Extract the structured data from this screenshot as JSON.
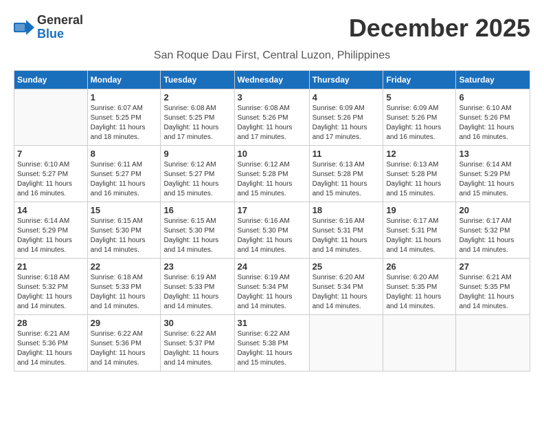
{
  "header": {
    "logo_general": "General",
    "logo_blue": "Blue",
    "month_title": "December 2025",
    "location": "San Roque Dau First, Central Luzon, Philippines"
  },
  "columns": [
    "Sunday",
    "Monday",
    "Tuesday",
    "Wednesday",
    "Thursday",
    "Friday",
    "Saturday"
  ],
  "weeks": [
    [
      {
        "day": "",
        "info": ""
      },
      {
        "day": "1",
        "info": "Sunrise: 6:07 AM\nSunset: 5:25 PM\nDaylight: 11 hours\nand 18 minutes."
      },
      {
        "day": "2",
        "info": "Sunrise: 6:08 AM\nSunset: 5:25 PM\nDaylight: 11 hours\nand 17 minutes."
      },
      {
        "day": "3",
        "info": "Sunrise: 6:08 AM\nSunset: 5:26 PM\nDaylight: 11 hours\nand 17 minutes."
      },
      {
        "day": "4",
        "info": "Sunrise: 6:09 AM\nSunset: 5:26 PM\nDaylight: 11 hours\nand 17 minutes."
      },
      {
        "day": "5",
        "info": "Sunrise: 6:09 AM\nSunset: 5:26 PM\nDaylight: 11 hours\nand 16 minutes."
      },
      {
        "day": "6",
        "info": "Sunrise: 6:10 AM\nSunset: 5:26 PM\nDaylight: 11 hours\nand 16 minutes."
      }
    ],
    [
      {
        "day": "7",
        "info": "Sunrise: 6:10 AM\nSunset: 5:27 PM\nDaylight: 11 hours\nand 16 minutes."
      },
      {
        "day": "8",
        "info": "Sunrise: 6:11 AM\nSunset: 5:27 PM\nDaylight: 11 hours\nand 16 minutes."
      },
      {
        "day": "9",
        "info": "Sunrise: 6:12 AM\nSunset: 5:27 PM\nDaylight: 11 hours\nand 15 minutes."
      },
      {
        "day": "10",
        "info": "Sunrise: 6:12 AM\nSunset: 5:28 PM\nDaylight: 11 hours\nand 15 minutes."
      },
      {
        "day": "11",
        "info": "Sunrise: 6:13 AM\nSunset: 5:28 PM\nDaylight: 11 hours\nand 15 minutes."
      },
      {
        "day": "12",
        "info": "Sunrise: 6:13 AM\nSunset: 5:28 PM\nDaylight: 11 hours\nand 15 minutes."
      },
      {
        "day": "13",
        "info": "Sunrise: 6:14 AM\nSunset: 5:29 PM\nDaylight: 11 hours\nand 15 minutes."
      }
    ],
    [
      {
        "day": "14",
        "info": "Sunrise: 6:14 AM\nSunset: 5:29 PM\nDaylight: 11 hours\nand 14 minutes."
      },
      {
        "day": "15",
        "info": "Sunrise: 6:15 AM\nSunset: 5:30 PM\nDaylight: 11 hours\nand 14 minutes."
      },
      {
        "day": "16",
        "info": "Sunrise: 6:15 AM\nSunset: 5:30 PM\nDaylight: 11 hours\nand 14 minutes."
      },
      {
        "day": "17",
        "info": "Sunrise: 6:16 AM\nSunset: 5:30 PM\nDaylight: 11 hours\nand 14 minutes."
      },
      {
        "day": "18",
        "info": "Sunrise: 6:16 AM\nSunset: 5:31 PM\nDaylight: 11 hours\nand 14 minutes."
      },
      {
        "day": "19",
        "info": "Sunrise: 6:17 AM\nSunset: 5:31 PM\nDaylight: 11 hours\nand 14 minutes."
      },
      {
        "day": "20",
        "info": "Sunrise: 6:17 AM\nSunset: 5:32 PM\nDaylight: 11 hours\nand 14 minutes."
      }
    ],
    [
      {
        "day": "21",
        "info": "Sunrise: 6:18 AM\nSunset: 5:32 PM\nDaylight: 11 hours\nand 14 minutes."
      },
      {
        "day": "22",
        "info": "Sunrise: 6:18 AM\nSunset: 5:33 PM\nDaylight: 11 hours\nand 14 minutes."
      },
      {
        "day": "23",
        "info": "Sunrise: 6:19 AM\nSunset: 5:33 PM\nDaylight: 11 hours\nand 14 minutes."
      },
      {
        "day": "24",
        "info": "Sunrise: 6:19 AM\nSunset: 5:34 PM\nDaylight: 11 hours\nand 14 minutes."
      },
      {
        "day": "25",
        "info": "Sunrise: 6:20 AM\nSunset: 5:34 PM\nDaylight: 11 hours\nand 14 minutes."
      },
      {
        "day": "26",
        "info": "Sunrise: 6:20 AM\nSunset: 5:35 PM\nDaylight: 11 hours\nand 14 minutes."
      },
      {
        "day": "27",
        "info": "Sunrise: 6:21 AM\nSunset: 5:35 PM\nDaylight: 11 hours\nand 14 minutes."
      }
    ],
    [
      {
        "day": "28",
        "info": "Sunrise: 6:21 AM\nSunset: 5:36 PM\nDaylight: 11 hours\nand 14 minutes."
      },
      {
        "day": "29",
        "info": "Sunrise: 6:22 AM\nSunset: 5:36 PM\nDaylight: 11 hours\nand 14 minutes."
      },
      {
        "day": "30",
        "info": "Sunrise: 6:22 AM\nSunset: 5:37 PM\nDaylight: 11 hours\nand 14 minutes."
      },
      {
        "day": "31",
        "info": "Sunrise: 6:22 AM\nSunset: 5:38 PM\nDaylight: 11 hours\nand 15 minutes."
      },
      {
        "day": "",
        "info": ""
      },
      {
        "day": "",
        "info": ""
      },
      {
        "day": "",
        "info": ""
      }
    ]
  ]
}
